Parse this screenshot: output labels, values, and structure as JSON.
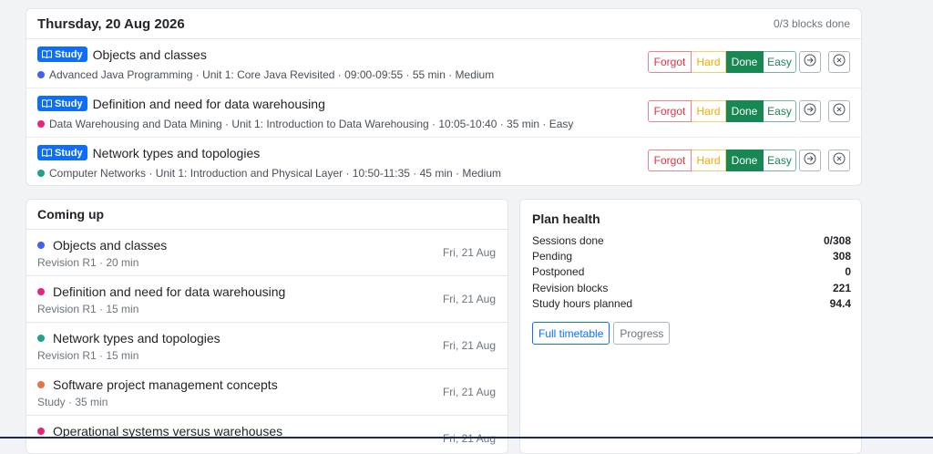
{
  "today": {
    "date": "Thursday, 20 Aug 2026",
    "blocks_done": "0/3 blocks done",
    "rating_labels": {
      "forgot": "Forgot",
      "hard": "Hard",
      "done": "Done",
      "easy": "Easy"
    },
    "tasks": [
      {
        "badge": "Study",
        "title": "Objects and classes",
        "color": "#4361ee",
        "meta": "Advanced Java Programming · Unit 1: Core Java Revisited · 09:00-09:55 · 55 min · Medium"
      },
      {
        "badge": "Study",
        "title": "Definition and need for data warehousing",
        "color": "#e7267a",
        "meta": "Data Warehousing and Data Mining · Unit 1: Introduction to Data Warehousing · 10:05-10:40 · 35 min · Easy"
      },
      {
        "badge": "Study",
        "title": "Network types and topologies",
        "color": "#23a08c",
        "meta": "Computer Networks · Unit 1: Introduction and Physical Layer · 10:50-11:35 · 45 min · Medium"
      }
    ]
  },
  "coming_up": {
    "title": "Coming up",
    "items": [
      {
        "title": "Objects and classes",
        "sub": "Revision R1 · 20 min",
        "date": "Fri, 21 Aug",
        "color": "#4361ee"
      },
      {
        "title": "Definition and need for data warehousing",
        "sub": "Revision R1 · 15 min",
        "date": "Fri, 21 Aug",
        "color": "#e7267a"
      },
      {
        "title": "Network types and topologies",
        "sub": "Revision R1 · 15 min",
        "date": "Fri, 21 Aug",
        "color": "#23a08c"
      },
      {
        "title": "Software project management concepts",
        "sub": "Study · 35 min",
        "date": "Fri, 21 Aug",
        "color": "#e8734a"
      },
      {
        "title": "Operational systems versus warehouses",
        "sub": "",
        "date": "Fri, 21 Aug",
        "color": "#e7267a"
      }
    ]
  },
  "plan_health": {
    "title": "Plan health",
    "stats": [
      {
        "label": "Sessions done",
        "value": "0/308"
      },
      {
        "label": "Pending",
        "value": "308"
      },
      {
        "label": "Postponed",
        "value": "0"
      },
      {
        "label": "Revision blocks",
        "value": "221"
      },
      {
        "label": "Study hours planned",
        "value": "94.4"
      }
    ],
    "full_timetable_label": "Full timetable",
    "progress_label": "Progress"
  }
}
